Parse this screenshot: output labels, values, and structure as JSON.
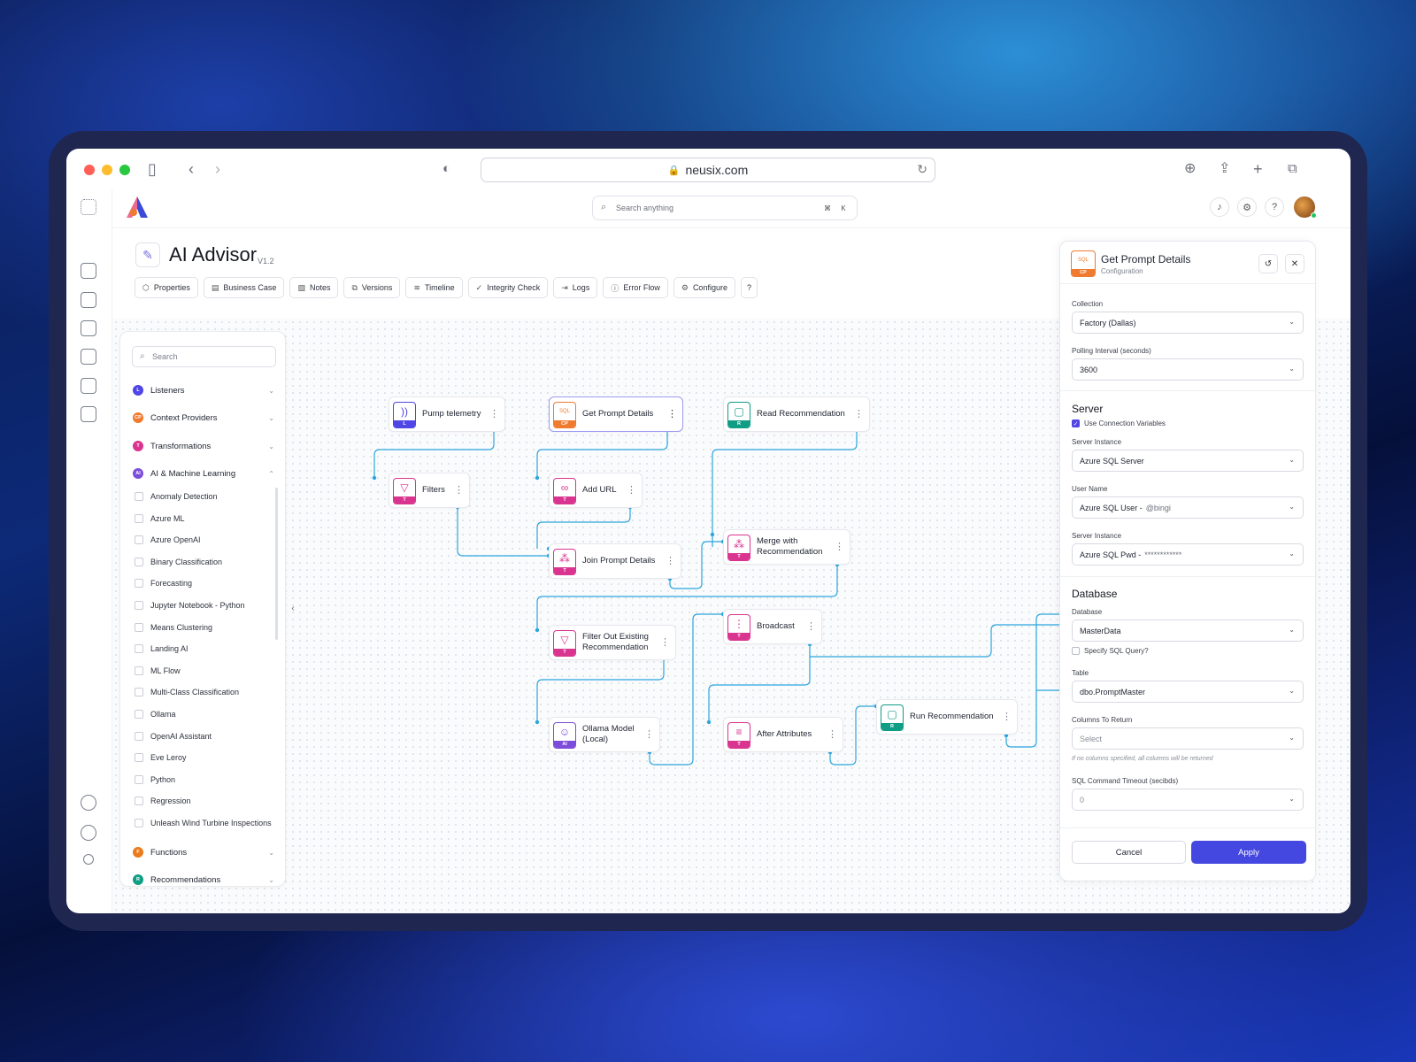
{
  "browser": {
    "url": "neusix.com"
  },
  "search_top": {
    "placeholder": "Search anything",
    "shortcut_mod": "⌘",
    "shortcut_key": "K"
  },
  "page": {
    "title": "AI Advisor",
    "version": "V1.2"
  },
  "toolbar": [
    {
      "label": "Properties",
      "icon": "cube-icon"
    },
    {
      "label": "Business Case",
      "icon": "briefcase-icon"
    },
    {
      "label": "Notes",
      "icon": "note-icon"
    },
    {
      "label": "Versions",
      "icon": "copy-icon"
    },
    {
      "label": "Timeline",
      "icon": "layers-icon"
    },
    {
      "label": "Integrity Check",
      "icon": "check-circle-icon"
    },
    {
      "label": "Logs",
      "icon": "login-icon"
    },
    {
      "label": "Error Flow",
      "icon": "alert-circle-icon"
    },
    {
      "label": "Configure",
      "icon": "gear-icon"
    }
  ],
  "palette": {
    "search_placeholder": "Search",
    "categories": [
      {
        "badge": "L",
        "label": "Listeners",
        "color": "#4f46e5"
      },
      {
        "badge": "CP",
        "label": "Context Providers",
        "color": "#f07a2e"
      },
      {
        "badge": "T",
        "label": "Transformations",
        "color": "#d9348f"
      },
      {
        "badge": "AI",
        "label": "AI & Machine Learning",
        "color": "#7c4ddb"
      },
      {
        "badge": "F",
        "label": "Functions",
        "color": "#ea7a1c"
      },
      {
        "badge": "R",
        "label": "Recommendations",
        "color": "#0f9d86"
      }
    ],
    "ai_items": [
      "Anomaly Detection",
      "Azure ML",
      "Azure OpenAI",
      "Binary Classification",
      "Forecasting",
      "Jupyter Notebook - Python",
      "Means Clustering",
      "Landing AI",
      "ML Flow",
      "Multi-Class Classification",
      "Ollama",
      "OpenAI Assistant",
      "Eve Leroy",
      "Python",
      "Regression",
      "Unleash Wind Turbine Inspections"
    ]
  },
  "nodes": {
    "pump": {
      "line1": "Pump telemetry",
      "line2": "",
      "tag": "L",
      "color": "#4f46e5",
      "glyph": "))"
    },
    "getprompt": {
      "line1": "Get Prompt Details",
      "line2": "",
      "tag": "CP",
      "color": "#f07a2e",
      "glyph": "SQL"
    },
    "readrec": {
      "line1": "Read Recommendation",
      "line2": "",
      "tag": "R",
      "color": "#0f9d86",
      "glyph": "▢"
    },
    "filters": {
      "line1": "Filters",
      "line2": "",
      "tag": "T",
      "color": "#d9348f",
      "glyph": "▽"
    },
    "addurl": {
      "line1": "Add URL",
      "line2": "",
      "tag": "T",
      "color": "#d9348f",
      "glyph": "∞"
    },
    "join": {
      "line1": "Join Prompt Details",
      "line2": "",
      "tag": "T",
      "color": "#d9348f",
      "glyph": "⁂"
    },
    "merge": {
      "line1": "Merge with",
      "line2": "Recommendation",
      "tag": "T",
      "color": "#d9348f",
      "glyph": "⁂"
    },
    "filterout": {
      "line1": "Filter Out Existing",
      "line2": "Recommendation",
      "tag": "T",
      "color": "#d9348f",
      "glyph": "▽"
    },
    "broadcast": {
      "line1": "Broadcast",
      "line2": "",
      "tag": "T",
      "color": "#d9348f",
      "glyph": "⋮"
    },
    "ollama": {
      "line1": "Ollama Model",
      "line2": "(Local)",
      "tag": "AI",
      "color": "#7c4ddb",
      "glyph": "☺"
    },
    "after": {
      "line1": "After Attributes",
      "line2": "",
      "tag": "T",
      "color": "#d9348f",
      "glyph": "≡"
    },
    "runrec": {
      "line1": "Run Recommendation",
      "line2": "",
      "tag": "R",
      "color": "#0f9d86",
      "glyph": "▢"
    }
  },
  "panel": {
    "title": "Get Prompt Details",
    "subtitle": "Configuration",
    "icon_tag": "CP",
    "icon_glyph": "SQL",
    "collection_label": "Collection",
    "collection_value": "Factory (Dallas)",
    "polling_label": "Polling Interval (seconds)",
    "polling_value": "3600",
    "server_title": "Server",
    "use_conn_vars": "Use Connection Variables",
    "server_instance_label": "Server Instance",
    "server_instance_value": "Azure SQL Server",
    "username_label": "User Name",
    "username_value": "Azure SQL User -",
    "username_suffix": "@bingi",
    "server_instance2_label": "Server Instance",
    "password_value": "Azure SQL Pwd -",
    "password_mask": "************",
    "database_title": "Database",
    "database_label": "Database",
    "database_value": "MasterData",
    "specify_sql": "Specify SQL Query?",
    "table_label": "Table",
    "table_value": "dbo.PromptMaster",
    "columns_label": "Columns To Return",
    "columns_placeholder": "Select",
    "columns_hint": "If no columns specified, all columns will be returned",
    "timeout_label": "SQL Command Timeout (secibds)",
    "timeout_value": "0",
    "cancel": "Cancel",
    "apply": "Apply"
  }
}
